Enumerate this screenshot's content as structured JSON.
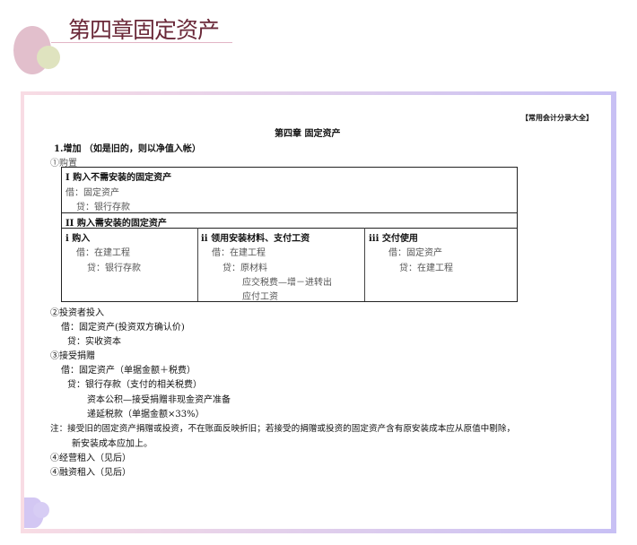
{
  "slide": {
    "title": "第四章固定资产"
  },
  "doc": {
    "source_tag": "【常用会计分录大全】",
    "chapter": "第四章  固定资产",
    "section": "1.增加 （如是旧的，则以净值入帐）",
    "s1": "①购置",
    "t_I": "I 购入不需安装的固定资产",
    "t_I_dr": "借：固定资产",
    "t_I_cr": "贷：银行存款",
    "t_II": "II 购入需安装的固定资产",
    "col_i": {
      "head": "i 购入",
      "l1": "借：在建工程",
      "l2": "贷：银行存款"
    },
    "col_ii": {
      "head": "ii 领用安装材料、支付工资",
      "l1": "借：在建工程",
      "l2": "贷：原材料",
      "l3": "应交税费—增－进转出",
      "l4": "应付工资"
    },
    "col_iii": {
      "head": "iii 交付使用",
      "l1": "借：固定资产",
      "l2": "贷：在建工程"
    },
    "s2": "②投资者投入",
    "s2_dr": "借：固定资产(投资双方确认价)",
    "s2_cr": "贷：实收资本",
    "s3": "③接受捐赠",
    "s3_dr": "借：固定资产（单据金额＋税费）",
    "s3_cr": "贷：银行存款（支付的相关税费）",
    "s3_cr2": "资本公积—接受捐赠非现金资产准备",
    "s3_cr3": "递延税款（单据金额×33%）",
    "note1": "注：接受旧的固定资产捐赠或投资，不在账面反映折旧；若接受的捐赠或投资的固定资产含有原安装成本应从原值中剔除，",
    "note2": "新安装成本应加上。",
    "s4": "④经营租入（见后）",
    "s5": "④融资租入（见后）"
  }
}
